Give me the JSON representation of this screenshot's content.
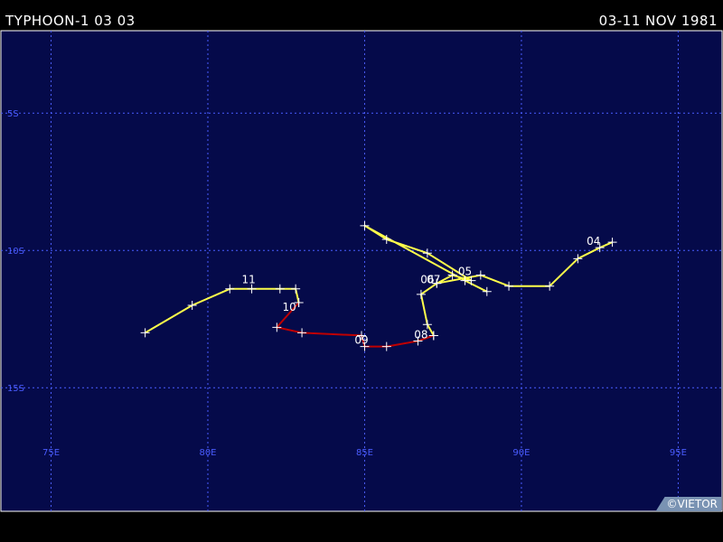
{
  "header": {
    "title": "TYPHOON-1 03 03",
    "dates": "03-11 NOV 1981"
  },
  "credit": "©VIETOR",
  "colors": {
    "ocean": "#050a4a",
    "grid": "#4a5cff",
    "label": "#4a5cff",
    "track": "#ffff4a",
    "track_strong": "#c00000",
    "border": "#ffffff"
  },
  "map": {
    "lon_range": [
      73.4,
      96.4
    ],
    "lat_range": [
      -2.0,
      -19.5
    ],
    "lon_lines": [
      75,
      80,
      85,
      90,
      95
    ],
    "lat_lines": [
      -5,
      -10,
      -15
    ],
    "lon_labels": [
      "75E",
      "80E",
      "85E",
      "90E",
      "95E"
    ],
    "lat_labels": [
      "5S",
      "10S",
      "15S"
    ]
  },
  "track": {
    "segments": [
      {
        "intensity": "weak",
        "points": [
          [
            92.9,
            -9.7
          ],
          [
            92.5,
            -9.9
          ],
          [
            91.8,
            -10.3
          ],
          [
            90.9,
            -11.3
          ],
          [
            89.6,
            -11.3
          ],
          [
            88.7,
            -10.9
          ],
          [
            87.3,
            -11.2
          ],
          [
            86.8,
            -11.6
          ],
          [
            87.0,
            -12.7
          ],
          [
            87.2,
            -13.1
          ]
        ]
      },
      {
        "intensity": "strong",
        "points": [
          [
            87.2,
            -13.1
          ],
          [
            86.7,
            -13.3
          ],
          [
            85.7,
            -13.5
          ],
          [
            85.0,
            -13.5
          ],
          [
            84.9,
            -13.1
          ],
          [
            83.0,
            -13.0
          ],
          [
            82.2,
            -12.8
          ],
          [
            82.9,
            -11.9
          ]
        ]
      },
      {
        "intensity": "weak",
        "points": [
          [
            82.9,
            -11.9
          ],
          [
            82.8,
            -11.4
          ],
          [
            82.3,
            -11.4
          ],
          [
            81.4,
            -11.4
          ],
          [
            80.7,
            -11.4
          ],
          [
            79.5,
            -12.0
          ],
          [
            78.0,
            -13.0
          ]
        ]
      },
      {
        "intensity": "weak",
        "points": [
          [
            87.3,
            -11.2
          ],
          [
            87.8,
            -10.9
          ],
          [
            88.4,
            -11.1
          ],
          [
            87.0,
            -10.1
          ],
          [
            85.7,
            -9.6
          ],
          [
            85.0,
            -9.1
          ],
          [
            88.2,
            -11.1
          ],
          [
            88.9,
            -11.5
          ]
        ]
      }
    ],
    "day_labels": [
      {
        "text": "04",
        "lon": 92.3,
        "lat": -9.8
      },
      {
        "text": "05",
        "lon": 88.2,
        "lat": -10.9
      },
      {
        "text": "06",
        "lon": 87.0,
        "lat": -11.2
      },
      {
        "text": "07",
        "lon": 87.2,
        "lat": -11.2
      },
      {
        "text": "08",
        "lon": 86.8,
        "lat": -13.2
      },
      {
        "text": "09",
        "lon": 84.9,
        "lat": -13.4
      },
      {
        "text": "10",
        "lon": 82.6,
        "lat": -12.2
      },
      {
        "text": "11",
        "lon": 81.3,
        "lat": -11.2
      }
    ]
  }
}
